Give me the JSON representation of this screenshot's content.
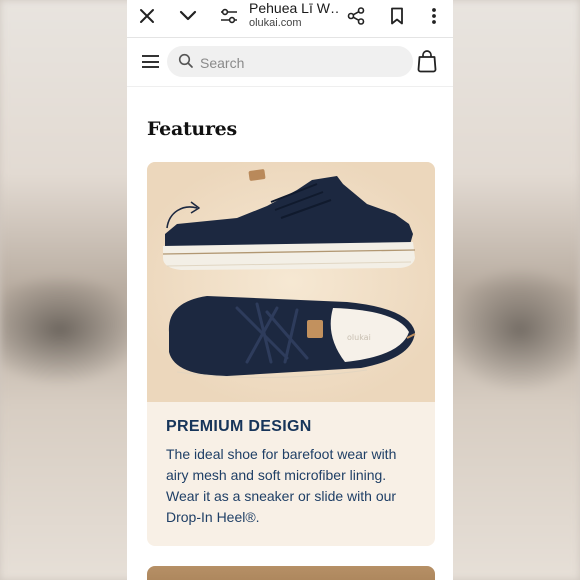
{
  "browser": {
    "page_title": "Pehuea Lī W…",
    "url": "olukai.com",
    "icons": [
      "close-icon",
      "chevron-down-icon",
      "tune-icon",
      "share-icon",
      "bookmark-icon",
      "more-vert-icon"
    ]
  },
  "site_header": {
    "search_placeholder": "Search",
    "icons": [
      "menu-icon",
      "search-icon",
      "shopping-bag-icon"
    ]
  },
  "section": {
    "title": "Features"
  },
  "feature_card": {
    "heading": "PREMIUM DESIGN",
    "body": "The ideal shoe for barefoot wear with airy mesh and soft microfiber lining. Wear it as a sneaker or slide with our Drop-In Heel®.",
    "insole_logo": "olukai",
    "colors": {
      "heading": "#17355a",
      "body": "#1f3f66",
      "background": "#f8f0e6",
      "shoe": "#1c2840"
    }
  }
}
